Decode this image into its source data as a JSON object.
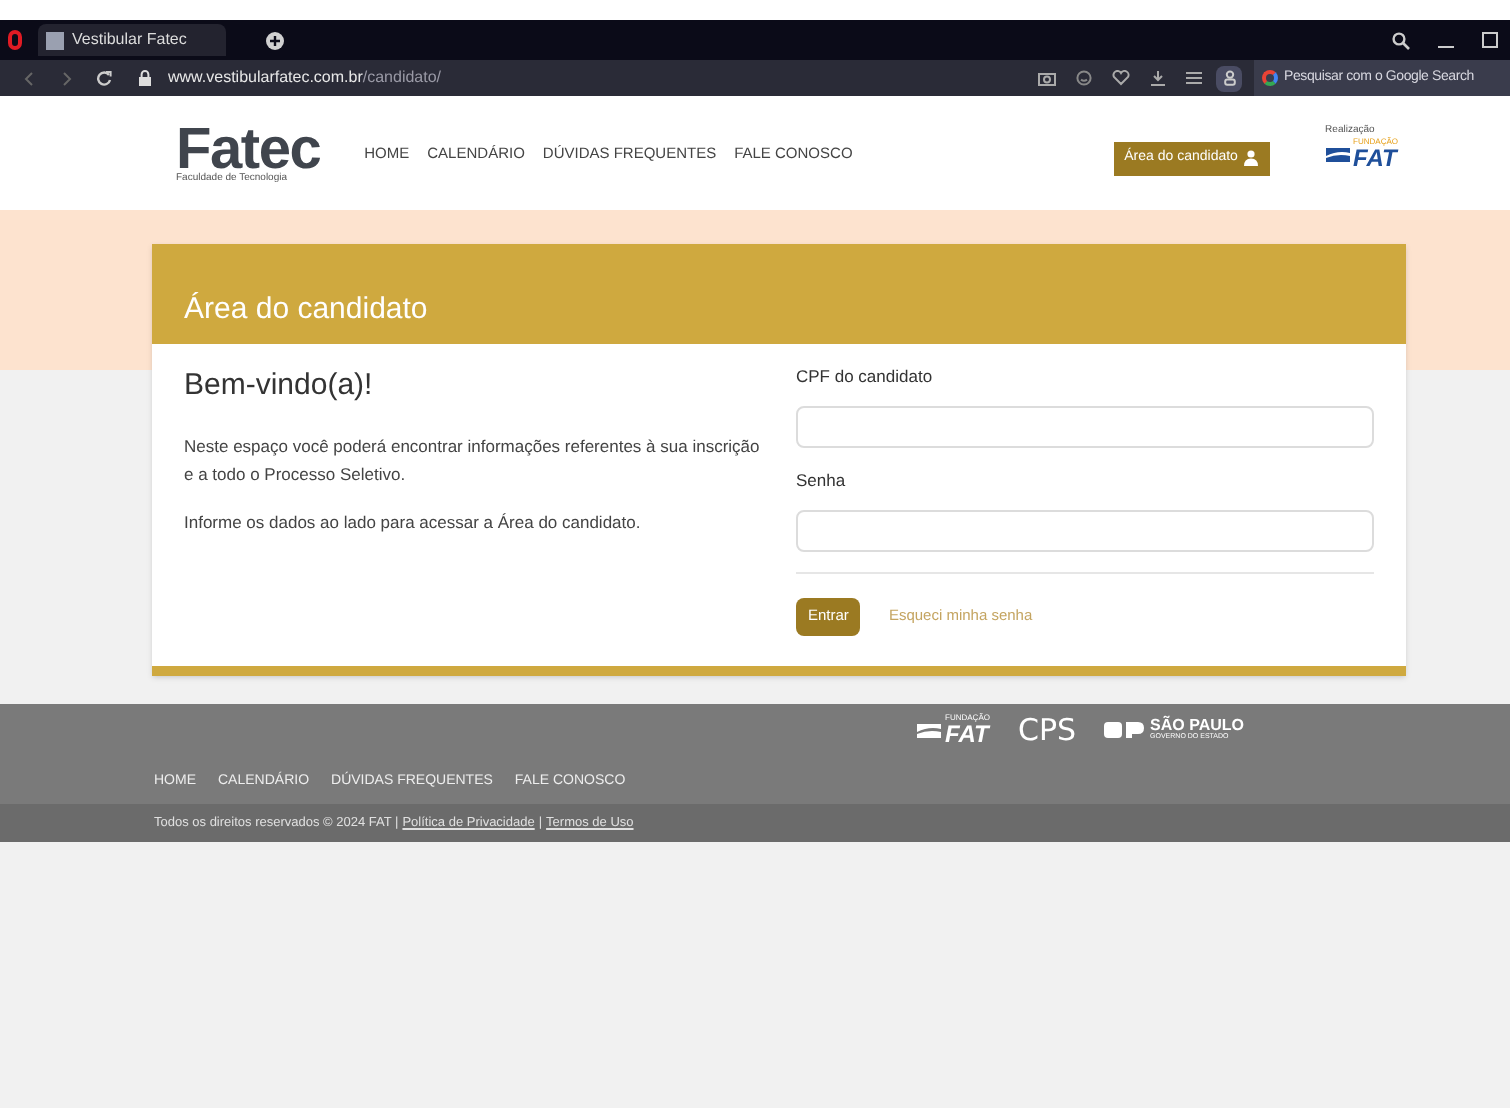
{
  "browser": {
    "tab_title": "Vestibular Fatec",
    "url_host": "www.vestibularfatec.com.br",
    "url_path": "/candidato/",
    "search_label": "Pesquisar com o Google Search"
  },
  "header": {
    "logo": "Fatec",
    "logo_subtitle": "Faculdade de Tecnologia",
    "nav": [
      "HOME",
      "CALENDÁRIO",
      "DÚVIDAS FREQUENTES",
      "FALE CONOSCO"
    ],
    "candidate_button": "Área do candidato",
    "sponsor_label": "Realização",
    "sponsor_small": "FUNDAÇÃO",
    "sponsor_logo": "FAT"
  },
  "card": {
    "title": "Área do candidato",
    "welcome": "Bem-vindo(a)!",
    "paragraphs": [
      "Neste espaço você poderá encontrar informações referentes à sua inscrição e a todo o Processo Seletivo.",
      "Informe os dados ao lado para acessar a Área do candidato."
    ],
    "fields": [
      {
        "label": "CPF do candidato"
      },
      {
        "label": "Senha"
      }
    ],
    "submit": "Entrar",
    "forgot_link": "Esqueci minha senha"
  },
  "footer": {
    "logos": {
      "fat_small": "FUNDAÇÃO",
      "fat": "FAT",
      "cps": "CPS",
      "sp_title": "SÃO PAULO",
      "sp_subtitle": "GOVERNO DO ESTADO"
    },
    "nav": [
      "HOME",
      "CALENDÁRIO",
      "DÚVIDAS FREQUENTES",
      "FALE CONOSCO"
    ],
    "copyright": "Todos os direitos reservados © 2024 FAT |",
    "links": [
      {
        "text": "Política de Privacidade"
      },
      {
        "text": "Termos de Uso"
      }
    ],
    "separator": "|"
  }
}
